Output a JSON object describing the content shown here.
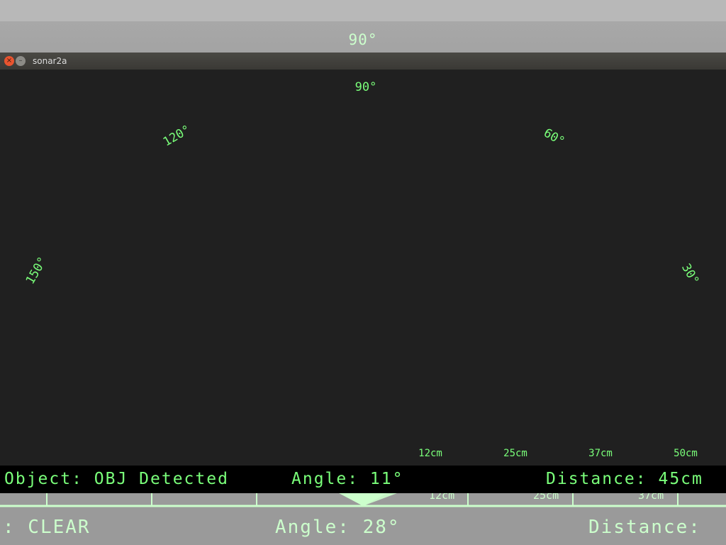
{
  "background_window": {
    "top_angle_label": "90°",
    "range_labels": [
      "12cm",
      "25cm",
      "37cm"
    ],
    "status": {
      "object_text": ": CLEAR",
      "angle_text": "Angle: 28°",
      "distance_text": "Distance:"
    }
  },
  "window": {
    "title": "sonar2a",
    "close_icon": "×",
    "minimize_icon": "–"
  },
  "radar": {
    "angle_labels": [
      "150°",
      "120°",
      "90°",
      "60°",
      "30°"
    ],
    "range_labels": [
      "12cm",
      "25cm",
      "37cm",
      "50cm"
    ]
  },
  "status": {
    "object_text": "Object: OBJ Detected",
    "angle_text": "Angle: 11°",
    "distance_text": "Distance: 45cm"
  },
  "colors": {
    "radar_green": "#7aff7a",
    "faded_green": "#ccffcc",
    "window_bg": "#202020",
    "status_bg": "#000000"
  }
}
